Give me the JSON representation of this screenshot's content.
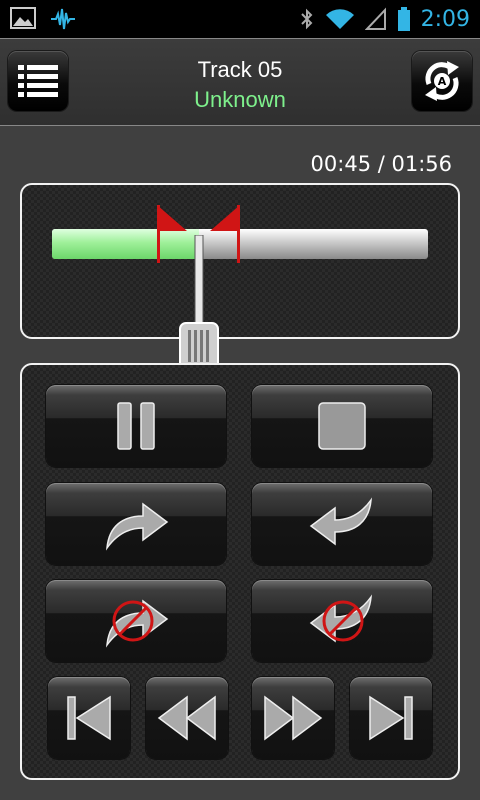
{
  "status_bar": {
    "time": "2:09"
  },
  "header": {
    "track_title": "Track 05",
    "artist": "Unknown",
    "menu_icon": "list-menu-icon",
    "repeat_icon": "ab-repeat-icon"
  },
  "playback": {
    "time_display": "00:45 / 01:56",
    "progress_fraction": 0.39,
    "marker_a_fraction": 0.28,
    "marker_b_fraction": 0.5
  },
  "controls": [
    {
      "name": "pause-button",
      "icon": "pause-icon"
    },
    {
      "name": "stop-button",
      "icon": "stop-icon"
    },
    {
      "name": "forward-jump-button",
      "icon": "curved-arrow-right-icon"
    },
    {
      "name": "back-jump-button",
      "icon": "curved-arrow-left-icon"
    },
    {
      "name": "forward-jump-disabled-button",
      "icon": "curved-arrow-right-disabled-icon"
    },
    {
      "name": "back-jump-disabled-button",
      "icon": "curved-arrow-left-disabled-icon"
    },
    {
      "name": "previous-track-button",
      "icon": "skip-previous-icon"
    },
    {
      "name": "rewind-button",
      "icon": "rewind-icon"
    },
    {
      "name": "fast-forward-button",
      "icon": "fast-forward-icon"
    },
    {
      "name": "next-track-button",
      "icon": "skip-next-icon"
    }
  ],
  "colors": {
    "accent_blue": "#33b5e5",
    "artist_green": "#7ef08c",
    "progress_green": "#9ff09a",
    "marker_red": "#e01818"
  }
}
